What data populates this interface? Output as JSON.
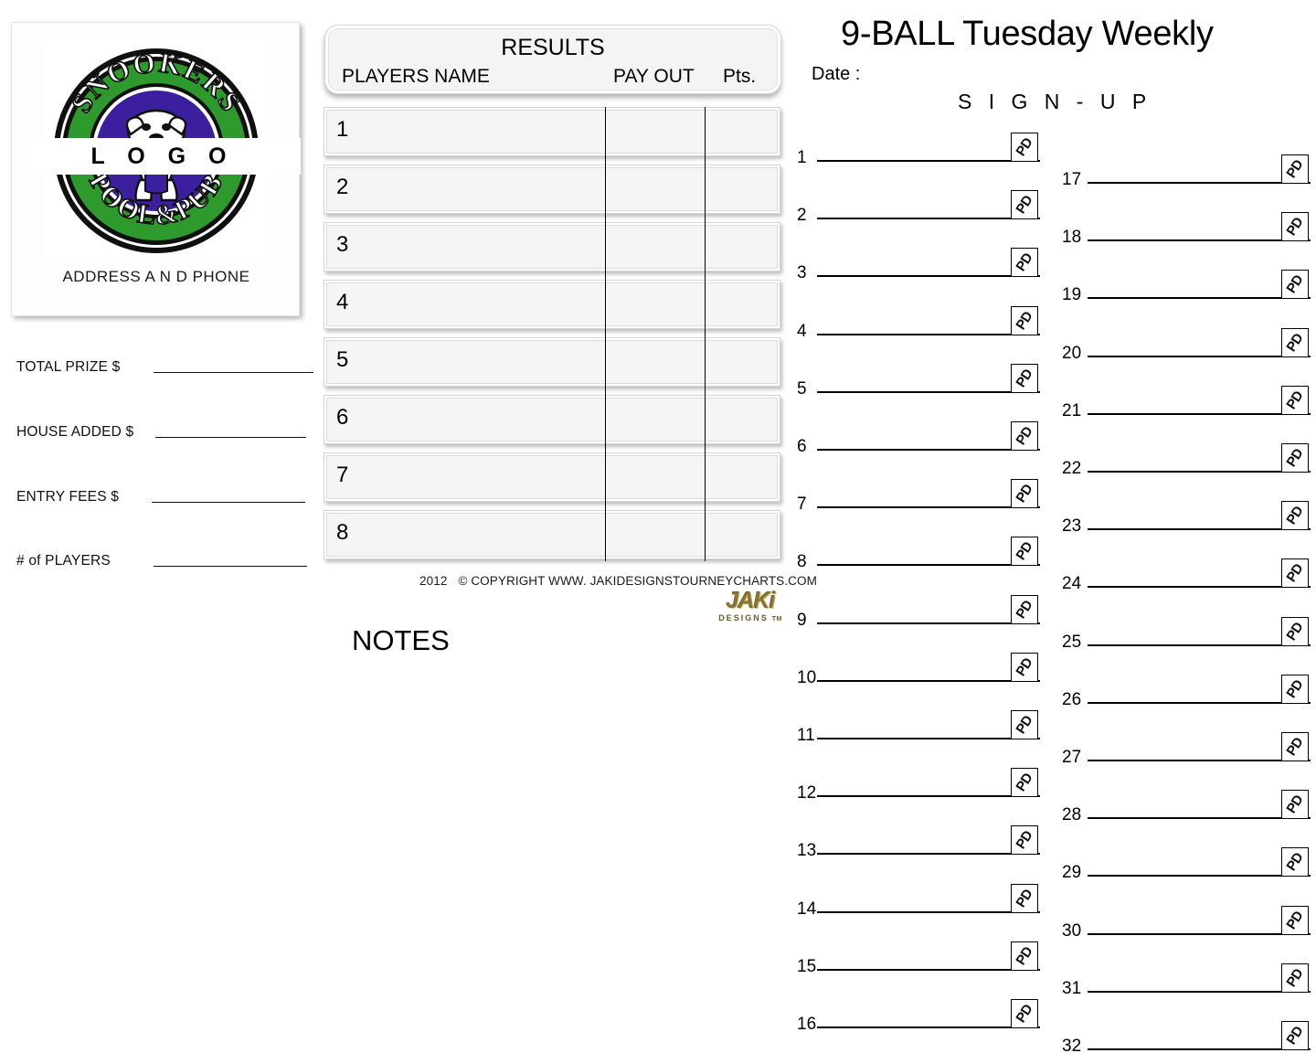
{
  "logo": {
    "overlay_text": "L O G O",
    "address_text": "ADDRESS    A N D    PHONE",
    "emblem_top_text": "SNOOKERS",
    "emblem_bottom_text": "POOL&PUB",
    "colors": {
      "ring_green": "#2e9a2e",
      "inner_purple": "#3b1f9e",
      "outline_black": "#101010",
      "emblem_white": "#ffffff"
    }
  },
  "tournament_fields": [
    {
      "label": "TOTAL PRIZE $",
      "value": ""
    },
    {
      "label": "HOUSE ADDED $",
      "value": ""
    },
    {
      "label": "ENTRY FEES $",
      "value": ""
    },
    {
      "label": "# of PLAYERS",
      "value": ""
    }
  ],
  "results": {
    "title": "RESULTS",
    "columns": [
      "PLAYERS NAME",
      "PAY OUT",
      "Pts."
    ],
    "rows": [
      {
        "place": "1",
        "player_name": "",
        "pay_out": "",
        "points": ""
      },
      {
        "place": "2",
        "player_name": "",
        "pay_out": "",
        "points": ""
      },
      {
        "place": "3",
        "player_name": "",
        "pay_out": "",
        "points": ""
      },
      {
        "place": "4",
        "player_name": "",
        "pay_out": "",
        "points": ""
      },
      {
        "place": "5",
        "player_name": "",
        "pay_out": "",
        "points": ""
      },
      {
        "place": "6",
        "player_name": "",
        "pay_out": "",
        "points": ""
      },
      {
        "place": "7",
        "player_name": "",
        "pay_out": "",
        "points": ""
      },
      {
        "place": "8",
        "player_name": "",
        "pay_out": "",
        "points": ""
      }
    ]
  },
  "footer": {
    "copyright_year": "2012",
    "copyright_text": "© COPYRIGHT WWW. JAKIDESIGNSTOURNEYCHARTS.COM",
    "brand_mark": "JAKi",
    "brand_sub": "DESIGNS",
    "brand_tm": "TM"
  },
  "notes": {
    "label": "NOTES"
  },
  "header": {
    "title": "9-BALL Tuesday Weekly",
    "date_label": "Date :",
    "signup_label": "S I G N  -  U P"
  },
  "signup": {
    "paid_box_mark": "PD",
    "left_column": [
      {
        "number": "1",
        "name": "",
        "paid": ""
      },
      {
        "number": "2",
        "name": "",
        "paid": ""
      },
      {
        "number": "3",
        "name": "",
        "paid": ""
      },
      {
        "number": "4",
        "name": "",
        "paid": ""
      },
      {
        "number": "5",
        "name": "",
        "paid": ""
      },
      {
        "number": "6",
        "name": "",
        "paid": ""
      },
      {
        "number": "7",
        "name": "",
        "paid": ""
      },
      {
        "number": "8",
        "name": "",
        "paid": ""
      },
      {
        "number": "9",
        "name": "",
        "paid": ""
      },
      {
        "number": "10",
        "name": "",
        "paid": ""
      },
      {
        "number": "11",
        "name": "",
        "paid": ""
      },
      {
        "number": "12",
        "name": "",
        "paid": ""
      },
      {
        "number": "13",
        "name": "",
        "paid": ""
      },
      {
        "number": "14",
        "name": "",
        "paid": ""
      },
      {
        "number": "15",
        "name": "",
        "paid": ""
      },
      {
        "number": "16",
        "name": "",
        "paid": ""
      }
    ],
    "right_column": [
      {
        "number": "17",
        "name": "",
        "paid": ""
      },
      {
        "number": "18",
        "name": "",
        "paid": ""
      },
      {
        "number": "19",
        "name": "",
        "paid": ""
      },
      {
        "number": "20",
        "name": "",
        "paid": ""
      },
      {
        "number": "21",
        "name": "",
        "paid": ""
      },
      {
        "number": "22",
        "name": "",
        "paid": ""
      },
      {
        "number": "23",
        "name": "",
        "paid": ""
      },
      {
        "number": "24",
        "name": "",
        "paid": ""
      },
      {
        "number": "25",
        "name": "",
        "paid": ""
      },
      {
        "number": "26",
        "name": "",
        "paid": ""
      },
      {
        "number": "27",
        "name": "",
        "paid": ""
      },
      {
        "number": "28",
        "name": "",
        "paid": ""
      },
      {
        "number": "29",
        "name": "",
        "paid": ""
      },
      {
        "number": "30",
        "name": "",
        "paid": ""
      },
      {
        "number": "31",
        "name": "",
        "paid": ""
      },
      {
        "number": "32",
        "name": "",
        "paid": ""
      }
    ]
  }
}
